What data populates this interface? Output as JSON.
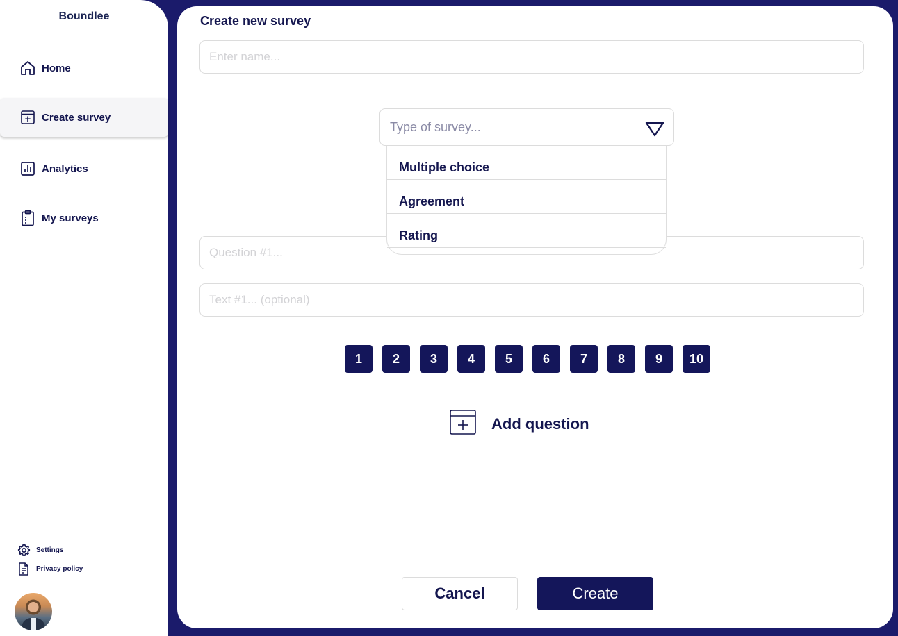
{
  "sidebar": {
    "brand": "Boundlee",
    "items": [
      {
        "label": "Home",
        "icon": "home-icon"
      },
      {
        "label": "Create survey",
        "icon": "create-survey-icon",
        "active": true
      },
      {
        "label": "Analytics",
        "icon": "analytics-icon"
      },
      {
        "label": "My surveys",
        "icon": "clipboard-icon"
      }
    ],
    "footer": {
      "settings_label": "Settings",
      "privacy_label": "Privacy policy"
    }
  },
  "main": {
    "title": "Create new survey",
    "name_input": {
      "placeholder": "Enter name...",
      "value": ""
    },
    "type_select": {
      "placeholder": "Type of survey...",
      "options": [
        "Multiple choice",
        "Agreement",
        "Rating"
      ]
    },
    "question_input": {
      "placeholder": "Question #1...",
      "value": ""
    },
    "text_input": {
      "placeholder": "Text #1... (optional)",
      "value": ""
    },
    "rating_scale": [
      "1",
      "2",
      "3",
      "4",
      "5",
      "6",
      "7",
      "8",
      "9",
      "10"
    ],
    "add_question_label": "Add question",
    "cancel_label": "Cancel",
    "create_label": "Create"
  },
  "colors": {
    "background": "#1b1b6b",
    "primary": "#14165a",
    "text": "#14164f",
    "placeholder": "#d3d3d6"
  }
}
